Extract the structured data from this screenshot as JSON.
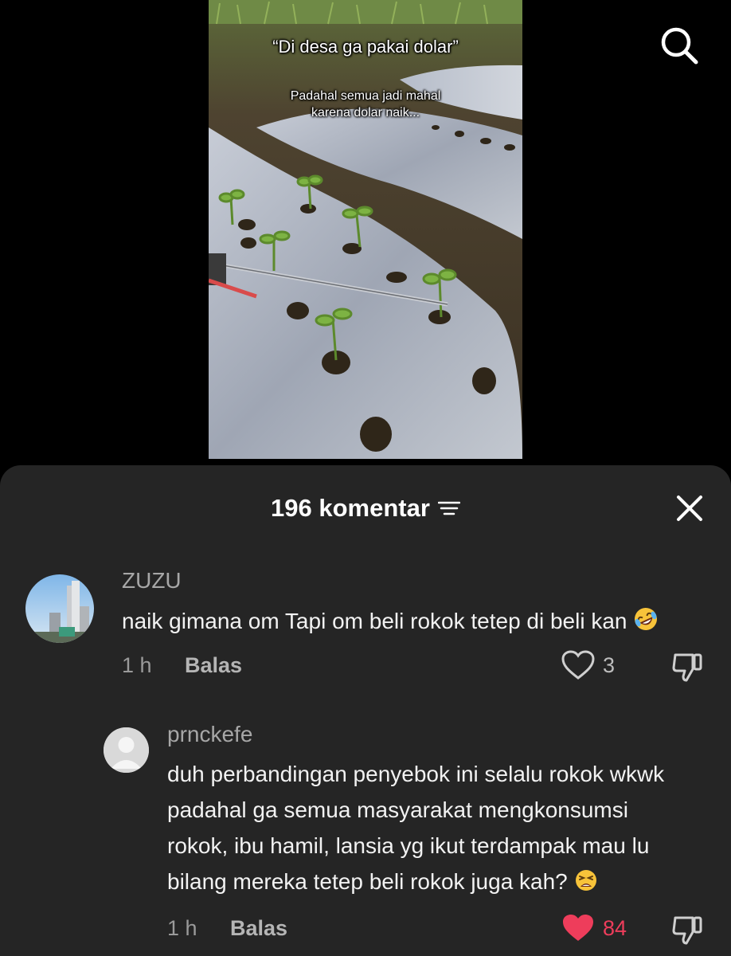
{
  "video": {
    "caption_main": "“Di desa ga pakai dolar”",
    "caption_sub_line1": "Padahal semua jadi mahal",
    "caption_sub_line2": "karena dolar naik..."
  },
  "header": {
    "title": "196 komentar",
    "icons": {
      "search": "search-icon",
      "sort": "sort-icon",
      "close": "close-icon"
    }
  },
  "comments": [
    {
      "username": "ZUZU",
      "text": "naik gimana om Tapi om beli rokok tetep di beli kan",
      "emoji": "rofl-emoji",
      "time": "1 h",
      "reply_label": "Balas",
      "likes": "3",
      "liked": false
    },
    {
      "username": "prnckefe",
      "text_lines": [
        "duh perbandingan penyebok ini selalu rokok wkwk",
        "padahal ga semua masyarakat mengkonsumsi",
        "rokok, ibu hamil, lansia yg ikut terdampak mau lu",
        "bilang mereka tetep beli rokok juga kah?"
      ],
      "emoji": "tired-face-emoji",
      "time": "1 h",
      "reply_label": "Balas",
      "likes": "84",
      "liked": true
    }
  ],
  "colors": {
    "sheet_bg": "#252525",
    "liked_heart": "#ee3d5b",
    "muted_text": "#9a9a9a"
  }
}
